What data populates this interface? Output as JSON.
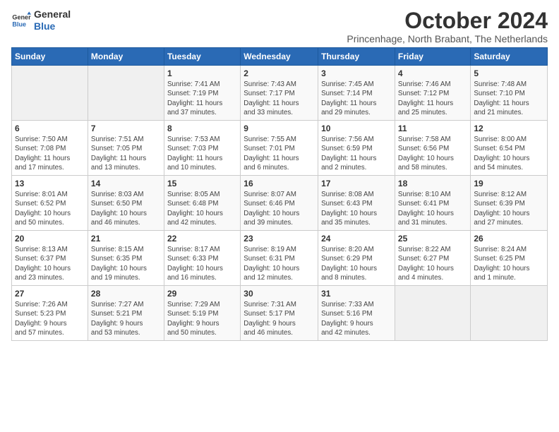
{
  "logo": {
    "line1": "General",
    "line2": "Blue"
  },
  "title": "October 2024",
  "subtitle": "Princenhage, North Brabant, The Netherlands",
  "weekdays": [
    "Sunday",
    "Monday",
    "Tuesday",
    "Wednesday",
    "Thursday",
    "Friday",
    "Saturday"
  ],
  "weeks": [
    [
      {
        "day": "",
        "info": ""
      },
      {
        "day": "",
        "info": ""
      },
      {
        "day": "1",
        "info": "Sunrise: 7:41 AM\nSunset: 7:19 PM\nDaylight: 11 hours\nand 37 minutes."
      },
      {
        "day": "2",
        "info": "Sunrise: 7:43 AM\nSunset: 7:17 PM\nDaylight: 11 hours\nand 33 minutes."
      },
      {
        "day": "3",
        "info": "Sunrise: 7:45 AM\nSunset: 7:14 PM\nDaylight: 11 hours\nand 29 minutes."
      },
      {
        "day": "4",
        "info": "Sunrise: 7:46 AM\nSunset: 7:12 PM\nDaylight: 11 hours\nand 25 minutes."
      },
      {
        "day": "5",
        "info": "Sunrise: 7:48 AM\nSunset: 7:10 PM\nDaylight: 11 hours\nand 21 minutes."
      }
    ],
    [
      {
        "day": "6",
        "info": "Sunrise: 7:50 AM\nSunset: 7:08 PM\nDaylight: 11 hours\nand 17 minutes."
      },
      {
        "day": "7",
        "info": "Sunrise: 7:51 AM\nSunset: 7:05 PM\nDaylight: 11 hours\nand 13 minutes."
      },
      {
        "day": "8",
        "info": "Sunrise: 7:53 AM\nSunset: 7:03 PM\nDaylight: 11 hours\nand 10 minutes."
      },
      {
        "day": "9",
        "info": "Sunrise: 7:55 AM\nSunset: 7:01 PM\nDaylight: 11 hours\nand 6 minutes."
      },
      {
        "day": "10",
        "info": "Sunrise: 7:56 AM\nSunset: 6:59 PM\nDaylight: 11 hours\nand 2 minutes."
      },
      {
        "day": "11",
        "info": "Sunrise: 7:58 AM\nSunset: 6:56 PM\nDaylight: 10 hours\nand 58 minutes."
      },
      {
        "day": "12",
        "info": "Sunrise: 8:00 AM\nSunset: 6:54 PM\nDaylight: 10 hours\nand 54 minutes."
      }
    ],
    [
      {
        "day": "13",
        "info": "Sunrise: 8:01 AM\nSunset: 6:52 PM\nDaylight: 10 hours\nand 50 minutes."
      },
      {
        "day": "14",
        "info": "Sunrise: 8:03 AM\nSunset: 6:50 PM\nDaylight: 10 hours\nand 46 minutes."
      },
      {
        "day": "15",
        "info": "Sunrise: 8:05 AM\nSunset: 6:48 PM\nDaylight: 10 hours\nand 42 minutes."
      },
      {
        "day": "16",
        "info": "Sunrise: 8:07 AM\nSunset: 6:46 PM\nDaylight: 10 hours\nand 39 minutes."
      },
      {
        "day": "17",
        "info": "Sunrise: 8:08 AM\nSunset: 6:43 PM\nDaylight: 10 hours\nand 35 minutes."
      },
      {
        "day": "18",
        "info": "Sunrise: 8:10 AM\nSunset: 6:41 PM\nDaylight: 10 hours\nand 31 minutes."
      },
      {
        "day": "19",
        "info": "Sunrise: 8:12 AM\nSunset: 6:39 PM\nDaylight: 10 hours\nand 27 minutes."
      }
    ],
    [
      {
        "day": "20",
        "info": "Sunrise: 8:13 AM\nSunset: 6:37 PM\nDaylight: 10 hours\nand 23 minutes."
      },
      {
        "day": "21",
        "info": "Sunrise: 8:15 AM\nSunset: 6:35 PM\nDaylight: 10 hours\nand 19 minutes."
      },
      {
        "day": "22",
        "info": "Sunrise: 8:17 AM\nSunset: 6:33 PM\nDaylight: 10 hours\nand 16 minutes."
      },
      {
        "day": "23",
        "info": "Sunrise: 8:19 AM\nSunset: 6:31 PM\nDaylight: 10 hours\nand 12 minutes."
      },
      {
        "day": "24",
        "info": "Sunrise: 8:20 AM\nSunset: 6:29 PM\nDaylight: 10 hours\nand 8 minutes."
      },
      {
        "day": "25",
        "info": "Sunrise: 8:22 AM\nSunset: 6:27 PM\nDaylight: 10 hours\nand 4 minutes."
      },
      {
        "day": "26",
        "info": "Sunrise: 8:24 AM\nSunset: 6:25 PM\nDaylight: 10 hours\nand 1 minute."
      }
    ],
    [
      {
        "day": "27",
        "info": "Sunrise: 7:26 AM\nSunset: 5:23 PM\nDaylight: 9 hours\nand 57 minutes."
      },
      {
        "day": "28",
        "info": "Sunrise: 7:27 AM\nSunset: 5:21 PM\nDaylight: 9 hours\nand 53 minutes."
      },
      {
        "day": "29",
        "info": "Sunrise: 7:29 AM\nSunset: 5:19 PM\nDaylight: 9 hours\nand 50 minutes."
      },
      {
        "day": "30",
        "info": "Sunrise: 7:31 AM\nSunset: 5:17 PM\nDaylight: 9 hours\nand 46 minutes."
      },
      {
        "day": "31",
        "info": "Sunrise: 7:33 AM\nSunset: 5:16 PM\nDaylight: 9 hours\nand 42 minutes."
      },
      {
        "day": "",
        "info": ""
      },
      {
        "day": "",
        "info": ""
      }
    ]
  ]
}
